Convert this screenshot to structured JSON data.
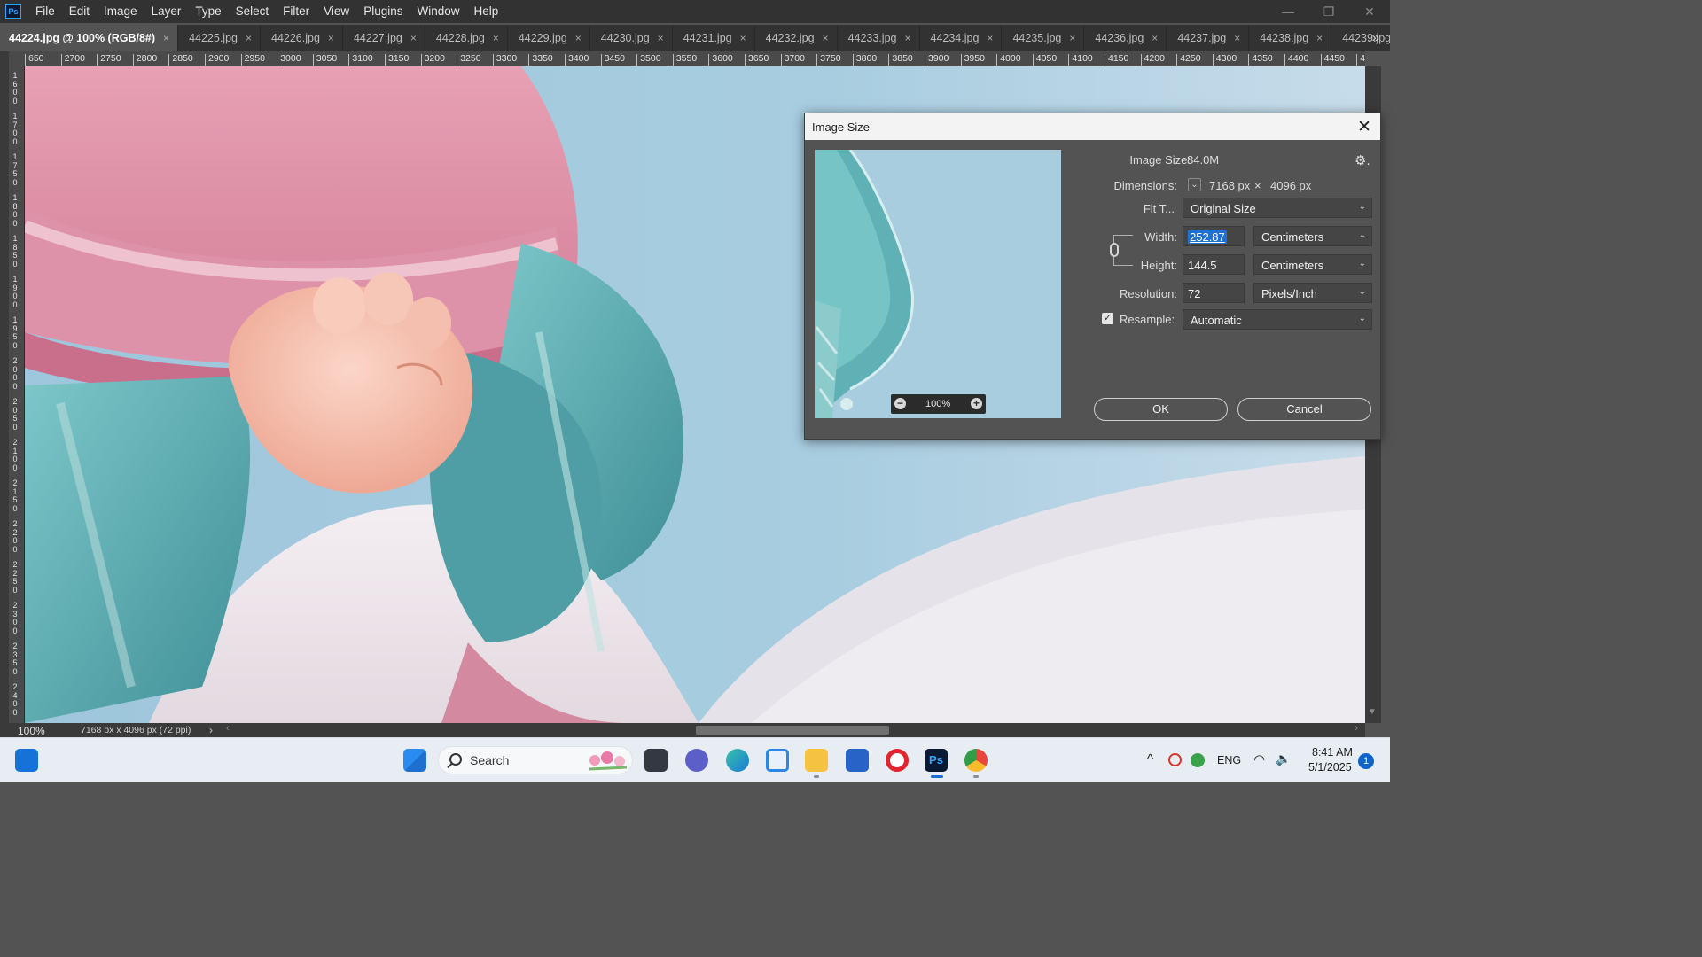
{
  "app": {
    "logo": "Ps",
    "menu": [
      "File",
      "Edit",
      "Image",
      "Layer",
      "Type",
      "Select",
      "Filter",
      "View",
      "Plugins",
      "Window",
      "Help"
    ],
    "window_controls": {
      "minimize": "—",
      "restore": "❐",
      "close": "✕"
    }
  },
  "tabs": [
    {
      "label": "44224.jpg @ 100% (RGB/8#)",
      "active": true
    },
    {
      "label": "44225.jpg"
    },
    {
      "label": "44226.jpg"
    },
    {
      "label": "44227.jpg"
    },
    {
      "label": "44228.jpg"
    },
    {
      "label": "44229.jpg"
    },
    {
      "label": "44230.jpg"
    },
    {
      "label": "44231.jpg"
    },
    {
      "label": "44232.jpg"
    },
    {
      "label": "44233.jpg"
    },
    {
      "label": "44234.jpg"
    },
    {
      "label": "44235.jpg"
    },
    {
      "label": "44236.jpg"
    },
    {
      "label": "44237.jpg"
    },
    {
      "label": "44238.jpg"
    },
    {
      "label": "44239.jpg"
    }
  ],
  "tab_close_glyph": "×",
  "tab_overflow": "»",
  "ruler": {
    "top_labels": [
      "650",
      "2700",
      "2750",
      "2800",
      "2850",
      "2900",
      "2950",
      "3000",
      "3050",
      "3100",
      "3150",
      "3200",
      "3250",
      "3300",
      "3350",
      "3400",
      "3450",
      "3500",
      "3550",
      "3600",
      "3650",
      "3700",
      "3750",
      "3800",
      "3850",
      "3900",
      "3950",
      "4000",
      "4050",
      "4100",
      "4150",
      "4200",
      "4250",
      "4300",
      "4350",
      "4400",
      "4450",
      "4"
    ],
    "left_labels": [
      "1\n6\n0\n0",
      "1\n7\n0\n0",
      "1\n7\n5\n0",
      "1\n8\n0\n0",
      "1\n8\n5\n0",
      "1\n9\n0\n0",
      "1\n9\n5\n0",
      "2\n0\n0\n0",
      "2\n0\n5\n0",
      "2\n1\n0\n0",
      "2\n1\n5\n0",
      "2\n2\n0\n0",
      "2\n2\n5\n0",
      "2\n3\n0\n0",
      "2\n3\n5\n0",
      "2\n4\n0\n0"
    ]
  },
  "status": {
    "zoom": "100%",
    "info": "7168 px x 4096 px (72 ppi)",
    "arrow": "›"
  },
  "dialog": {
    "title": "Image Size",
    "close": "✕",
    "preview_zoom": "100%",
    "image_size_label": "Image Size:",
    "image_size_value": "84.0M",
    "dimensions_label": "Dimensions:",
    "dimensions_width": "7168 px",
    "dimensions_sep": "×",
    "dimensions_height": "4096 px",
    "fit_label": "Fit T...",
    "fit_value": "Original Size",
    "width_label": "Width:",
    "width_value": "252.87",
    "width_unit": "Centimeters",
    "height_label": "Height:",
    "height_value": "144.5",
    "height_unit": "Centimeters",
    "resolution_label": "Resolution:",
    "resolution_value": "72",
    "resolution_unit": "Pixels/Inch",
    "resample_label": "Resample:",
    "resample_checked": true,
    "resample_value": "Automatic",
    "ok_label": "OK",
    "cancel_label": "Cancel",
    "check_glyph": "✓",
    "gear_glyph": "⚙."
  },
  "taskbar": {
    "search_label": "Search",
    "language": "ENG",
    "time": "8:41 AM",
    "date": "5/1/2025",
    "notification_count": "1"
  },
  "colors": {
    "ps_blue": "#31a8ff",
    "selection": "#1d71d3",
    "dialog_bg": "#535353",
    "taskbar_bg": "#e8edf3"
  }
}
